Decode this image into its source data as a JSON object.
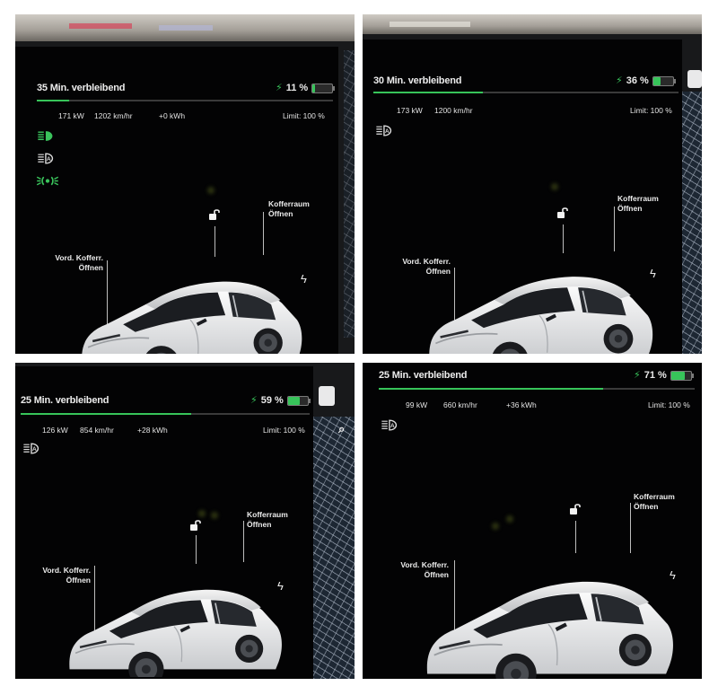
{
  "panels": [
    {
      "remaining": "35 Min. verbleibend",
      "charge_percent": "11 %",
      "charge_fraction": 0.11,
      "stats": {
        "power": "171 kW",
        "speed": "1202 km/hr",
        "energy": "+0 kWh",
        "limit": "Limit: 100 %"
      },
      "front_trunk": {
        "line1": "Vord. Kofferr.",
        "line2": "Öffnen"
      },
      "trunk": {
        "line1": "Kofferraum",
        "line2": "Öffnen"
      },
      "icons": [
        "headlight-green-icon",
        "auto-high-beam-icon",
        "parking-light-green-icon",
        "unlock-icon",
        "charge-port-bolt-icon"
      ]
    },
    {
      "remaining": "30 Min. verbleibend",
      "charge_percent": "36 %",
      "charge_fraction": 0.36,
      "stats": {
        "power": "173 kW",
        "speed": "1200 km/hr",
        "limit": "Limit: 100 %"
      },
      "front_trunk": {
        "line1": "Vord. Kofferr.",
        "line2": "Öffnen"
      },
      "trunk": {
        "line1": "Kofferraum",
        "line2": "Öffnen"
      },
      "icons": [
        "auto-high-beam-icon",
        "unlock-icon",
        "charge-port-bolt-icon"
      ]
    },
    {
      "remaining": "25 Min. verbleibend",
      "charge_percent": "59 %",
      "charge_fraction": 0.59,
      "stats": {
        "power": "126 kW",
        "speed": "854 km/hr",
        "energy": "+28 kWh",
        "limit": "Limit: 100 %"
      },
      "front_trunk": {
        "line1": "Vord. Kofferr.",
        "line2": "Öffnen"
      },
      "trunk": {
        "line1": "Kofferraum",
        "line2": "Öffnen"
      },
      "icons": [
        "auto-high-beam-icon",
        "unlock-icon",
        "charge-port-bolt-icon",
        "search-icon"
      ]
    },
    {
      "remaining": "25 Min. verbleibend",
      "charge_percent": "71 %",
      "charge_fraction": 0.71,
      "stats": {
        "power": "99 kW",
        "speed": "660 km/hr",
        "energy": "+36 kWh",
        "limit": "Limit: 100 %"
      },
      "front_trunk": {
        "line1": "Vord. Kofferr.",
        "line2": "Öffnen"
      },
      "trunk": {
        "line1": "Kofferraum",
        "line2": "Öffnen"
      },
      "icons": [
        "auto-high-beam-icon",
        "unlock-icon",
        "charge-port-bolt-icon"
      ]
    }
  ],
  "colors": {
    "charge_green": "#37c45a",
    "screen_bg": "#030304",
    "text": "#ececec"
  },
  "glyphs": {
    "bolt": "⚡",
    "plug": "ϟ",
    "search": "⌕"
  }
}
